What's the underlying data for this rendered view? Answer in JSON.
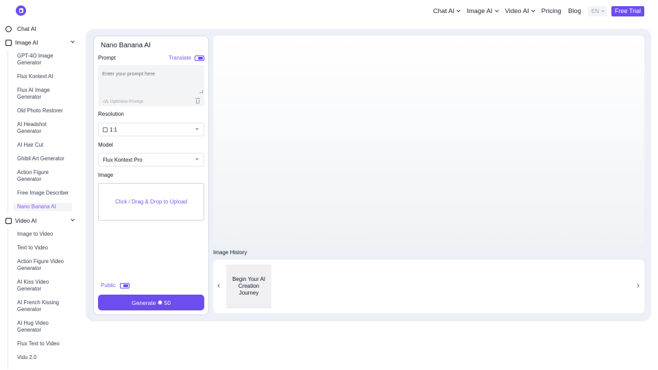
{
  "nav": {
    "items": [
      {
        "label": "Chat AI",
        "dropdown": true
      },
      {
        "label": "Image AI",
        "dropdown": true
      },
      {
        "label": "Video AI",
        "dropdown": true
      },
      {
        "label": "Pricing",
        "dropdown": false
      },
      {
        "label": "Blog",
        "dropdown": false
      }
    ],
    "lang": "EN",
    "trial": "Free Trial"
  },
  "sidebar": {
    "chat": "Chat AI",
    "image": "Image AI",
    "image_items": [
      "GPT-4O Image Generator",
      "Flux Kontext AI",
      "Flux AI Image Generator",
      "Old Photo Restorer",
      "AI Headshot Generator",
      "AI Hair Cut",
      "Ghibli Art Generator",
      "Action Figure Generator",
      "Free Image Describer",
      "Nano Banana AI"
    ],
    "active": "Nano Banana AI",
    "video": "Video AI",
    "video_items": [
      "Image to Video",
      "Text to Video",
      "Action Figure Video Generator",
      "AI Kiss Video Generator",
      "AI French Kissing Generator",
      "AI Hug Video Generator",
      "Flux Text to Video",
      "Vidu 2.0"
    ]
  },
  "panel": {
    "title": "Nano Banana AI",
    "prompt_label": "Prompt",
    "translate": "Translate",
    "prompt_placeholder": "Enter your prompt here",
    "optimize": "Optimize Prompt",
    "resolution_label": "Resolution",
    "resolution_value": "1:1",
    "model_label": "Model",
    "model_value": "Flux Kontext Pro",
    "image_label": "Image",
    "upload_text": "Click / Drag & Drop to Upload",
    "public": "Public",
    "generate": "Generate",
    "credits": "50"
  },
  "history": {
    "label": "Image History",
    "card": "Begin Your AI Creation Journey"
  },
  "colors": {
    "accent": "#6d4cf0",
    "background": "#eef0f7"
  }
}
